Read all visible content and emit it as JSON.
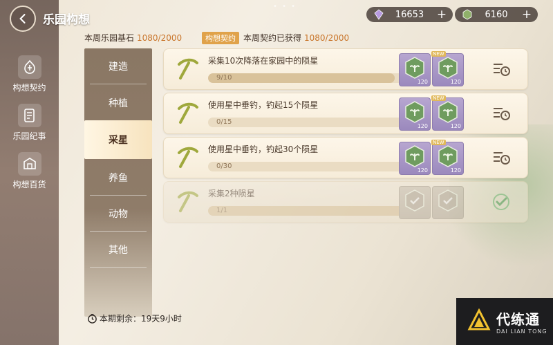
{
  "header": {
    "title": "乐园构想",
    "currency1": {
      "value": "16653",
      "plus": "+",
      "icon": "purple-gem-icon",
      "color": "#a98ad1"
    },
    "currency2": {
      "value": "6160",
      "plus": "+",
      "icon": "green-crystal-icon",
      "color": "#7fa35c"
    }
  },
  "stats": {
    "stone_label": "本周乐园基石",
    "stone_value": "1080/2000",
    "badge": "构想契约",
    "contract_label": "本周契约已获得",
    "contract_value": "1080/2000"
  },
  "leftnav": [
    {
      "label": "构想契约",
      "icon": "contract-icon"
    },
    {
      "label": "乐园纪事",
      "icon": "journal-icon"
    },
    {
      "label": "构想百货",
      "icon": "shop-icon"
    }
  ],
  "categories": [
    {
      "label": "建造"
    },
    {
      "label": "种植"
    },
    {
      "label": "采星"
    },
    {
      "label": "养鱼"
    },
    {
      "label": "动物"
    },
    {
      "label": "其他"
    }
  ],
  "tasks": [
    {
      "desc": "采集10次降落在家园中的陨星",
      "progress": "9/10",
      "fraction": 0.9,
      "reward_count": "120",
      "status": "pending"
    },
    {
      "desc": "使用星中垂钓，钓起15个陨星",
      "progress": "0/15",
      "fraction": 0.0,
      "reward_count": "120",
      "status": "pending"
    },
    {
      "desc": "使用星中垂钓，钓起30个陨星",
      "progress": "0/30",
      "fraction": 0.0,
      "reward_count": "120",
      "status": "pending"
    },
    {
      "desc": "采集2种陨星",
      "progress": "1/1",
      "fraction": 1.0,
      "reward_count": "",
      "status": "done"
    }
  ],
  "reward_tag": "NEW",
  "footer": {
    "timer": "本期剩余：19天9小时"
  },
  "watermark": {
    "main": "代练通",
    "sub": "DAI LIAN TONG"
  }
}
